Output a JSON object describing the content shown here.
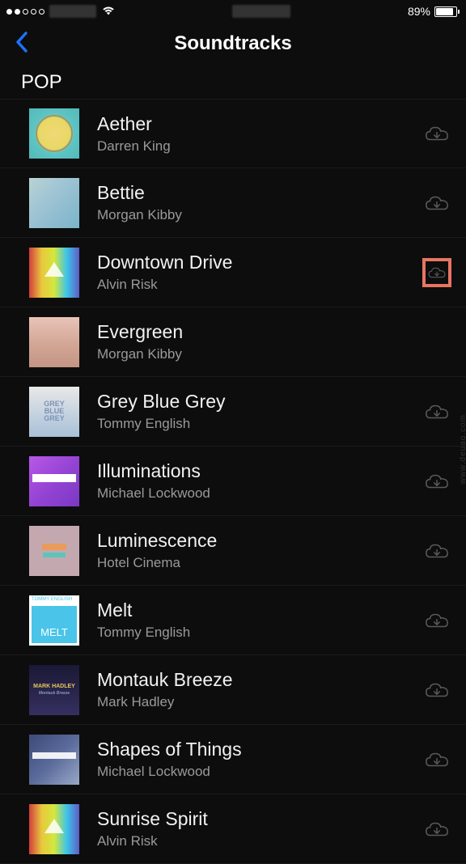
{
  "statusBar": {
    "signalFilled": 2,
    "signalTotal": 5,
    "batteryPercent": "89%",
    "batteryFill": 89
  },
  "header": {
    "title": "Soundtracks"
  },
  "section": {
    "title": "POP"
  },
  "tracks": [
    {
      "title": "Aether",
      "artist": "Darren King",
      "hasDownload": true,
      "highlighted": false,
      "art": "aether"
    },
    {
      "title": "Bettie",
      "artist": "Morgan Kibby",
      "hasDownload": true,
      "highlighted": false,
      "art": "bettie"
    },
    {
      "title": "Downtown Drive",
      "artist": "Alvin Risk",
      "hasDownload": true,
      "highlighted": true,
      "art": "downtown"
    },
    {
      "title": "Evergreen",
      "artist": "Morgan Kibby",
      "hasDownload": false,
      "highlighted": false,
      "art": "evergreen"
    },
    {
      "title": "Grey Blue Grey",
      "artist": "Tommy English",
      "hasDownload": true,
      "highlighted": false,
      "art": "greyblue"
    },
    {
      "title": "Illuminations",
      "artist": "Michael Lockwood",
      "hasDownload": true,
      "highlighted": false,
      "art": "illuminations"
    },
    {
      "title": "Luminescence",
      "artist": "Hotel Cinema",
      "hasDownload": true,
      "highlighted": false,
      "art": "luminescence"
    },
    {
      "title": "Melt",
      "artist": "Tommy English",
      "hasDownload": true,
      "highlighted": false,
      "art": "melt"
    },
    {
      "title": "Montauk Breeze",
      "artist": "Mark Hadley",
      "hasDownload": true,
      "highlighted": false,
      "art": "montauk"
    },
    {
      "title": "Shapes of Things",
      "artist": "Michael Lockwood",
      "hasDownload": true,
      "highlighted": false,
      "art": "shapes"
    },
    {
      "title": "Sunrise Spirit",
      "artist": "Alvin Risk",
      "hasDownload": true,
      "highlighted": false,
      "art": "sunrise"
    }
  ],
  "albumLabels": {
    "greyblue": {
      "l1": "GREY",
      "l2": "BLUE",
      "l3": "GREY"
    },
    "melt": {
      "header": "TOMMY ENGLISH",
      "body": "MELT"
    },
    "montauk": {
      "l1": "MARK HADLEY",
      "l2": "Montauk Breeze"
    }
  },
  "watermark": "www.deuaq.com"
}
